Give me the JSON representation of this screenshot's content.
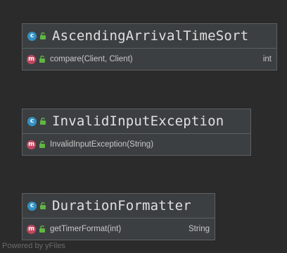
{
  "diagram": {
    "classes": [
      {
        "name": "AscendingArrivalTimeSort",
        "icon": "class-icon",
        "members": [
          {
            "icon": "method-icon",
            "name": "compare(Client, Client)",
            "type": "int"
          }
        ]
      },
      {
        "name": "InvalidInputException",
        "icon": "class-icon",
        "members": [
          {
            "icon": "method-icon",
            "name": "InvalidInputException(String)",
            "type": ""
          }
        ]
      },
      {
        "name": "DurationFormatter",
        "icon": "class-icon",
        "members": [
          {
            "icon": "method-icon",
            "name": "getTimerFormat(int)",
            "type": "String"
          }
        ]
      }
    ],
    "watermark": "Powered by yFiles"
  },
  "badges": {
    "class_letter": "c",
    "method_letter": "m"
  },
  "colors": {
    "background": "#2b2b2b",
    "box_fill": "#3c3f41",
    "box_border": "#5e6060",
    "class_badge": "#3592c4",
    "method_badge": "#c0475e",
    "public_visibility": "#62b543",
    "text": "#e0e0e0"
  }
}
